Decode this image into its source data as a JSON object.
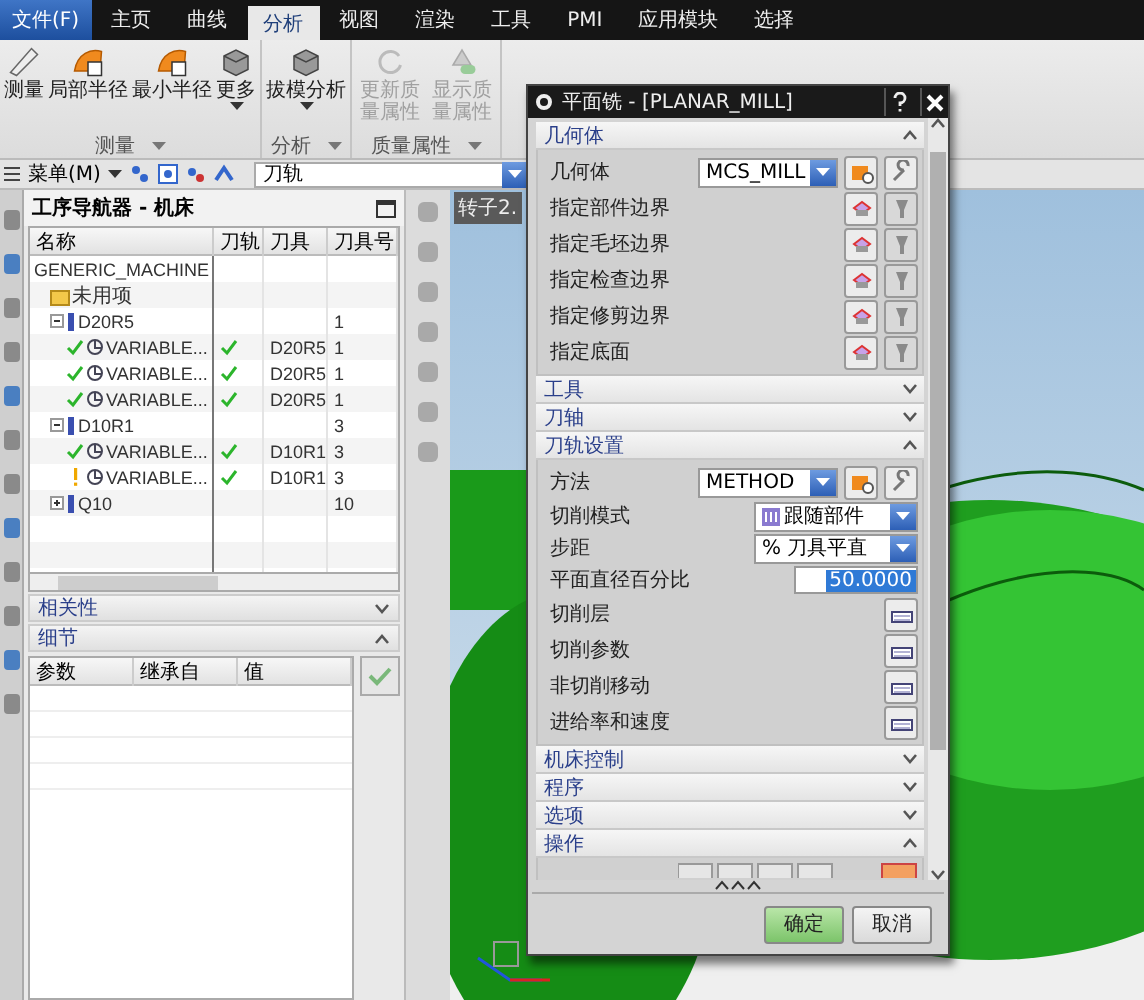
{
  "menu_bar": {
    "file_button": "文件(F)",
    "tabs": [
      {
        "label": "主页",
        "selected": false
      },
      {
        "label": "曲线",
        "selected": false
      },
      {
        "label": "分析",
        "selected": true
      },
      {
        "label": "视图",
        "selected": false
      },
      {
        "label": "渲染",
        "selected": false
      },
      {
        "label": "工具",
        "selected": false
      },
      {
        "label": "PMI",
        "selected": false
      },
      {
        "label": "应用模块",
        "selected": false
      },
      {
        "label": "选择",
        "selected": false
      }
    ]
  },
  "ribbon": {
    "groups": [
      {
        "label": "测量",
        "buttons": [
          {
            "label": "测量",
            "kind": "ruler",
            "disabled": false,
            "has_menu": false
          },
          {
            "label": "局部半径",
            "kind": "surface",
            "disabled": false,
            "has_menu": false
          },
          {
            "label": "最小半径",
            "kind": "surface",
            "disabled": false,
            "has_menu": false
          },
          {
            "label": "更多",
            "kind": "cube",
            "disabled": false,
            "has_menu": true
          }
        ]
      },
      {
        "label": "分析",
        "buttons": [
          {
            "label": "拔模分析",
            "kind": "cube",
            "disabled": false,
            "has_menu": true
          }
        ]
      },
      {
        "label": "质量属性",
        "buttons": [
          {
            "label": "更新质量属性",
            "kind": "refresh",
            "disabled": true,
            "has_menu": false
          },
          {
            "label": "显示质量属性",
            "kind": "mass",
            "disabled": true,
            "has_menu": false
          }
        ]
      }
    ]
  },
  "toolbar": {
    "menu": "菜单(M)",
    "filter": "刀轨"
  },
  "navigator": {
    "title": "工序导航器 - 机床",
    "columns": [
      "名称",
      "刀轨",
      "刀具",
      "刀具号"
    ],
    "tree": [
      {
        "name": "GENERIC_MACHINE",
        "children": [
          {
            "name": "未用项",
            "kind": "folder"
          },
          {
            "name": "D20R5",
            "kind": "tool",
            "tool_number": "1",
            "expanded": true,
            "children": [
              {
                "name": "VARIABLE...",
                "kind": "operation",
                "complete": true,
                "toolpath": true,
                "tool": "D20R5",
                "tool_number": "1"
              },
              {
                "name": "VARIABLE...",
                "kind": "operation",
                "complete": true,
                "toolpath": true,
                "tool": "D20R5",
                "tool_number": "1"
              },
              {
                "name": "VARIABLE...",
                "kind": "operation",
                "complete": true,
                "toolpath": true,
                "tool": "D20R5",
                "tool_number": "1"
              }
            ]
          },
          {
            "name": "D10R1",
            "kind": "tool",
            "tool_number": "3",
            "expanded": true,
            "children": [
              {
                "name": "VARIABLE...",
                "kind": "operation",
                "complete": true,
                "toolpath": true,
                "tool": "D10R1",
                "tool_number": "3"
              },
              {
                "name": "VARIABLE...",
                "kind": "operation",
                "complete": false,
                "toolpath": true,
                "tool": "D10R1",
                "tool_number": "3"
              }
            ]
          },
          {
            "name": "Q10",
            "kind": "tool",
            "tool_number": "10",
            "expanded": false
          }
        ]
      }
    ]
  },
  "panels": [
    {
      "title": "相关性",
      "expanded": false
    },
    {
      "title": "细节",
      "expanded": true,
      "columns": [
        "参数",
        "继承自",
        "值"
      ]
    }
  ],
  "viewport": {
    "tab": "转子2."
  },
  "dialog": {
    "title": "平面铣 - [PLANAR_MILL]",
    "sections": [
      {
        "title": "几何体",
        "expanded": true,
        "rows": [
          {
            "kind": "select",
            "label": "几何体",
            "value": "MCS_MILL"
          },
          {
            "kind": "picker",
            "label": "指定部件边界"
          },
          {
            "kind": "picker",
            "label": "指定毛坯边界"
          },
          {
            "kind": "picker",
            "label": "指定检查边界"
          },
          {
            "kind": "picker",
            "label": "指定修剪边界"
          },
          {
            "kind": "picker",
            "label": "指定底面"
          }
        ]
      },
      {
        "title": "工具",
        "expanded": false
      },
      {
        "title": "刀轴",
        "expanded": false
      },
      {
        "title": "刀轨设置",
        "expanded": true,
        "rows": [
          {
            "kind": "select",
            "label": "方法",
            "value": "METHOD"
          },
          {
            "kind": "dropdown",
            "label": "切削模式",
            "value": "跟随部件",
            "has_icon": true
          },
          {
            "kind": "dropdown",
            "label": "步距",
            "value": "% 刀具平直",
            "has_icon": false
          },
          {
            "kind": "number",
            "label": "平面直径百分比",
            "value": "50.0000",
            "highlighted": true
          },
          {
            "kind": "action",
            "label": "切削层"
          },
          {
            "kind": "action",
            "label": "切削参数"
          },
          {
            "kind": "action",
            "label": "非切削移动"
          },
          {
            "kind": "action",
            "label": "进给率和速度"
          }
        ]
      },
      {
        "title": "机床控制",
        "expanded": false
      },
      {
        "title": "程序",
        "expanded": false
      },
      {
        "title": "选项",
        "expanded": false
      },
      {
        "title": "操作",
        "expanded": true,
        "rows": [
          {
            "kind": "toolstrip"
          }
        ]
      }
    ],
    "buttons": [
      {
        "label": "确定",
        "kind": "primary"
      },
      {
        "label": "取消",
        "kind": "secondary"
      }
    ]
  }
}
